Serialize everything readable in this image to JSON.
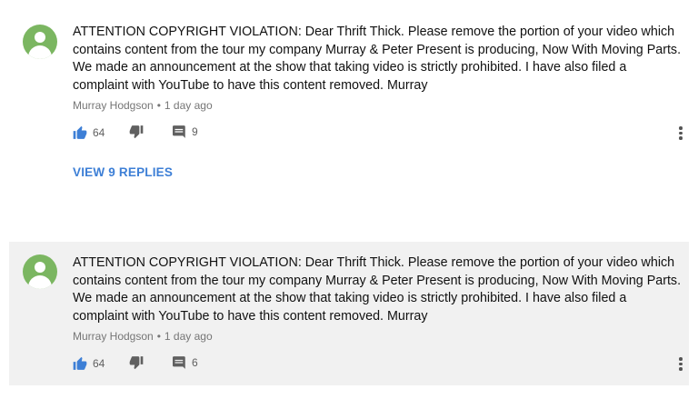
{
  "comments": [
    {
      "text": "ATTENTION COPYRIGHT VIOLATION: Dear Thrift Thick. Please remove the portion of your video which contains content from the tour my company Murray & Peter Present is producing, Now With Moving Parts. We made an announcement at the show that taking video is strictly prohibited. I have also filed a complaint with YouTube to have this content removed. Murray",
      "author": "Murray Hodgson",
      "separator": "•",
      "time": "1 day ago",
      "likes": "64",
      "reply_count": "9",
      "view_replies_label": "VIEW 9 REPLIES"
    },
    {
      "text": "ATTENTION COPYRIGHT VIOLATION: Dear Thrift Thick. Please remove the portion of your video which contains content from the tour my company Murray & Peter Present is producing, Now With Moving Parts. We made an announcement at the show that taking video is strictly prohibited. I have also filed a complaint with YouTube to have this content removed. Murray",
      "author": "Murray Hodgson",
      "separator": "•",
      "time": "1 day ago",
      "likes": "64",
      "reply_count": "6"
    }
  ],
  "icons": {
    "like": "thumbs-up-icon",
    "dislike": "thumbs-down-icon",
    "reply": "comment-icon",
    "more": "more-vert-icon",
    "avatar": "default-avatar"
  },
  "colors": {
    "like_active": "#3d7fd6",
    "link": "#3d7fd6",
    "avatar": "#7bb661",
    "highlight_bg": "#f1f1f1",
    "meta_text": "#767676"
  }
}
